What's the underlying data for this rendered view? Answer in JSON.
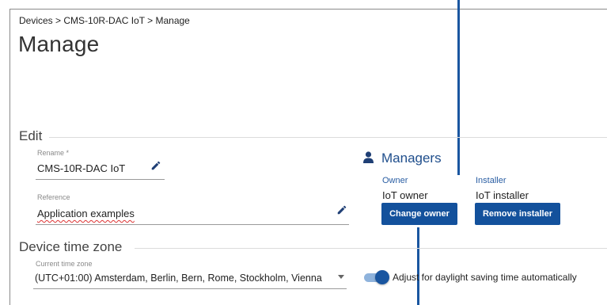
{
  "breadcrumb": "Devices > CMS-10R-DAC IoT > Manage",
  "page_title": "Manage",
  "edit": {
    "section_title": "Edit",
    "rename": {
      "label": "Rename *",
      "value": "CMS-10R-DAC IoT",
      "icon": "pencil-icon"
    },
    "reference": {
      "label": "Reference",
      "value": "Application examples",
      "icon": "pencil-icon"
    }
  },
  "managers": {
    "title": "Managers",
    "icon": "person-icon",
    "owner": {
      "label": "Owner",
      "value": "IoT owner",
      "button": "Change owner"
    },
    "installer": {
      "label": "Installer",
      "value": "IoT installer",
      "button": "Remove installer"
    }
  },
  "timezone": {
    "section_title": "Device time zone",
    "select_label": "Current time zone",
    "select_value": "(UTC+01:00) Amsterdam, Berlin, Bern, Rome, Stockholm, Vienna",
    "dst_toggle_label": "Adjust for daylight saving time automatically",
    "dst_enabled": true
  },
  "colors": {
    "accent": "#13519c",
    "callout": "#1a56a0",
    "label_blue": "#2a5ea3"
  }
}
